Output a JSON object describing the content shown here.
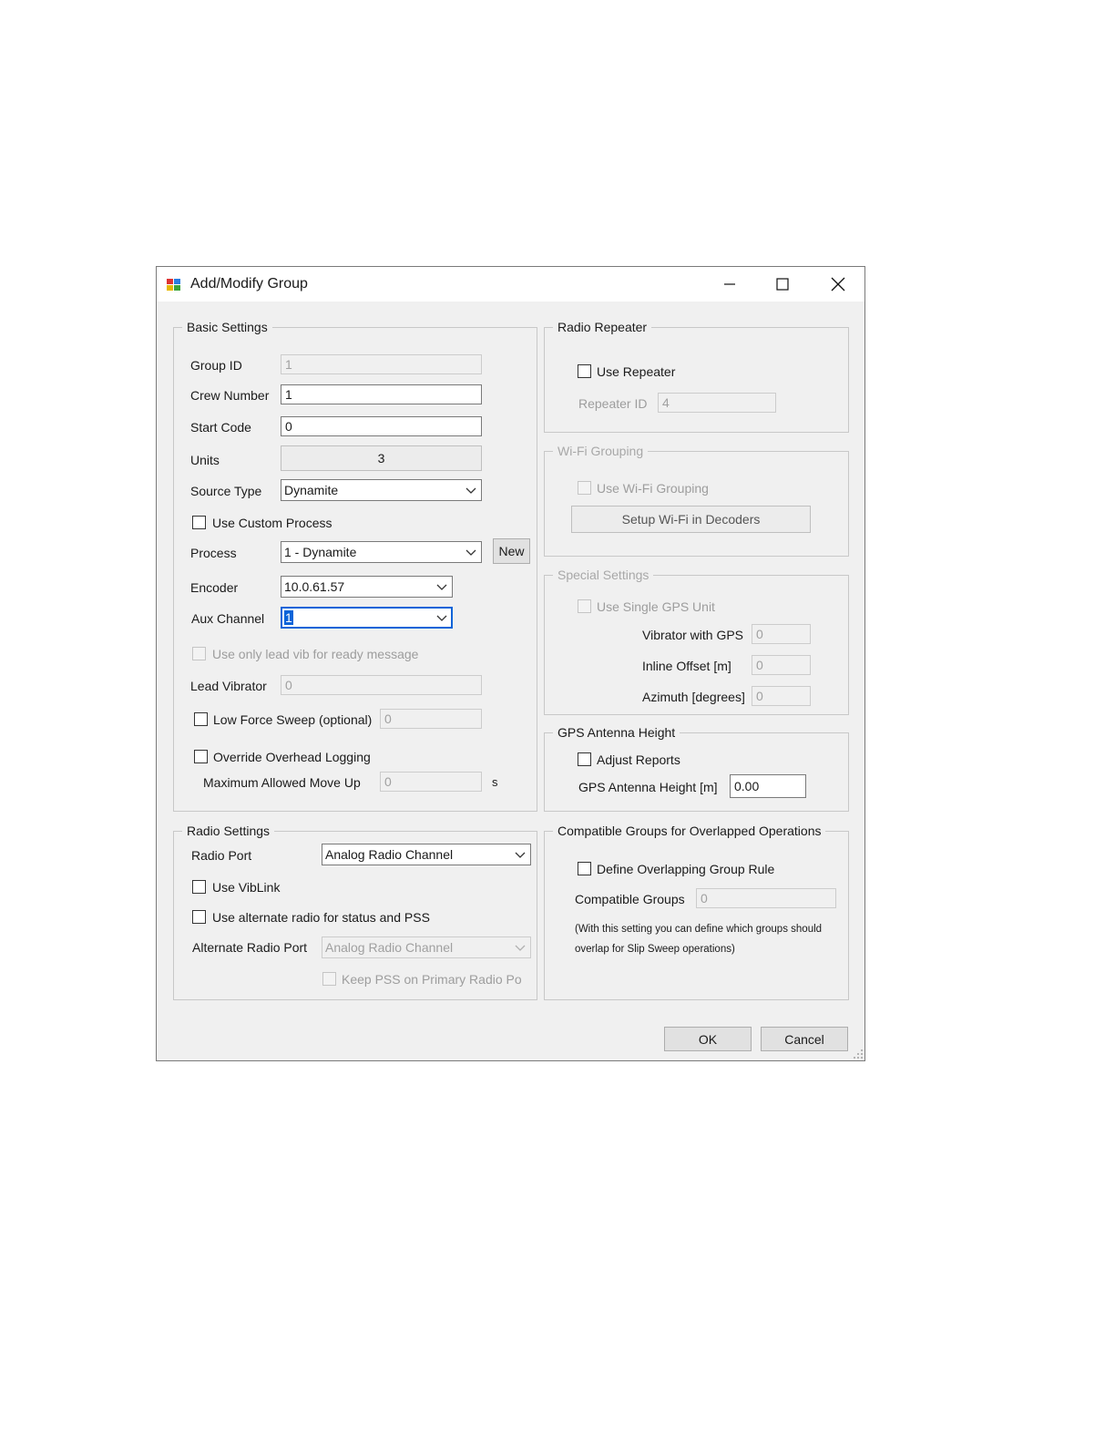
{
  "window": {
    "title": "Add/Modify Group"
  },
  "basic_settings": {
    "legend": "Basic Settings",
    "group_id_label": "Group ID",
    "group_id_value": "1",
    "crew_number_label": "Crew Number",
    "crew_number_value": "1",
    "start_code_label": "Start Code",
    "start_code_value": "0",
    "units_label": "Units",
    "units_value": "3",
    "source_type_label": "Source Type",
    "source_type_value": "Dynamite",
    "use_custom_process_label": "Use Custom Process",
    "process_label": "Process",
    "process_value": "1 - Dynamite",
    "new_button": "New",
    "encoder_label": "Encoder",
    "encoder_value": "10.0.61.57",
    "aux_channel_label": "Aux Channel",
    "aux_channel_value": "1",
    "use_lead_vib_label": "Use only lead vib for ready message",
    "lead_vibrator_label": "Lead Vibrator",
    "lead_vibrator_value": "0",
    "low_force_sweep_label": "Low Force Sweep (optional)",
    "low_force_sweep_value": "0",
    "override_overhead_label": "Override Overhead Logging",
    "max_move_up_label": "Maximum Allowed Move Up",
    "max_move_up_value": "0",
    "max_move_up_unit": "s"
  },
  "radio_settings": {
    "legend": "Radio Settings",
    "radio_port_label": "Radio Port",
    "radio_port_value": "Analog Radio Channel",
    "use_viblink_label": "Use VibLink",
    "use_alternate_label": "Use alternate radio for status and PSS",
    "alternate_port_label": "Alternate Radio Port",
    "alternate_port_value": "Analog Radio Channel",
    "keep_pss_label": "Keep PSS on Primary Radio Port"
  },
  "radio_repeater": {
    "legend": "Radio Repeater",
    "use_repeater_label": "Use Repeater",
    "repeater_id_label": "Repeater ID",
    "repeater_id_value": "4"
  },
  "wifi_grouping": {
    "legend": "Wi-Fi Grouping",
    "use_wifi_label": "Use Wi-Fi Grouping",
    "setup_button": "Setup Wi-Fi in Decoders"
  },
  "special_settings": {
    "legend": "Special Settings",
    "single_gps_label": "Use Single GPS Unit",
    "vibrator_gps_label": "Vibrator with GPS",
    "vibrator_gps_value": "0",
    "inline_offset_label": "Inline Offset [m]",
    "inline_offset_value": "0",
    "azimuth_label": "Azimuth [degrees]",
    "azimuth_value": "0"
  },
  "gps_antenna": {
    "legend": "GPS Antenna Height",
    "adjust_reports_label": "Adjust Reports",
    "height_label": "GPS Antenna Height [m]",
    "height_value": "0.00"
  },
  "compatible_groups": {
    "legend": "Compatible Groups for Overlapped Operations",
    "define_rule_label": "Define Overlapping Group Rule",
    "groups_label": "Compatible Groups",
    "groups_value": "0",
    "note_line1": "(With this setting you can define which groups should",
    "note_line2": "overlap for Slip Sweep operations)"
  },
  "footer": {
    "ok": "OK",
    "cancel": "Cancel"
  }
}
